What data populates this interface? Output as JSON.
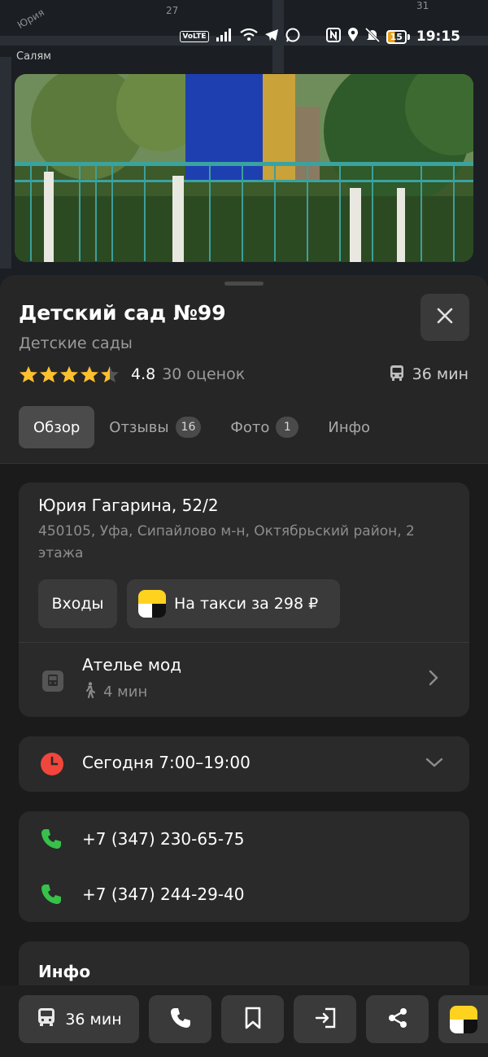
{
  "status_bar": {
    "volte": "VoLTE",
    "time": "19:15",
    "battery_level": "15",
    "icons": [
      "signal-icon",
      "wifi-icon",
      "telegram-icon",
      "whatsapp-icon",
      "nfc-icon",
      "location-icon",
      "mute-icon",
      "battery-icon"
    ]
  },
  "map": {
    "labels": [
      "27",
      "31",
      "Салям",
      "Юрия"
    ]
  },
  "place": {
    "title": "Детский сад №99",
    "category": "Детские сады",
    "rating": "4.8",
    "rating_stars": 4.5,
    "rating_count": "30 оценок",
    "transit_time": "36 мин"
  },
  "tabs": [
    {
      "label": "Обзор",
      "badge": ""
    },
    {
      "label": "Отзывы",
      "badge": "16"
    },
    {
      "label": "Фото",
      "badge": "1"
    },
    {
      "label": "Инфо",
      "badge": ""
    }
  ],
  "address": {
    "street": "Юрия Гагарина, 52/2",
    "details": "450105, Уфа, Сипайлово м-н, Октябрьский район, 2 этажа",
    "entrances_label": "Входы",
    "taxi_label": "На такси за 298 ₽",
    "stop_name": "Ателье мод",
    "walk_time": "4 мин"
  },
  "hours": {
    "label": "Сегодня 7:00–19:00"
  },
  "phones": [
    "+7 (347) 230-65-75",
    "+7 (347) 244-29-40"
  ],
  "info": {
    "title": "Инфо"
  },
  "actions": {
    "route_label": "36 мин"
  },
  "colors": {
    "accent_green": "#38c14a",
    "clock_red": "#f0463c",
    "star_yellow": "#fcc02e",
    "yandex_yellow": "#ffd21f"
  }
}
